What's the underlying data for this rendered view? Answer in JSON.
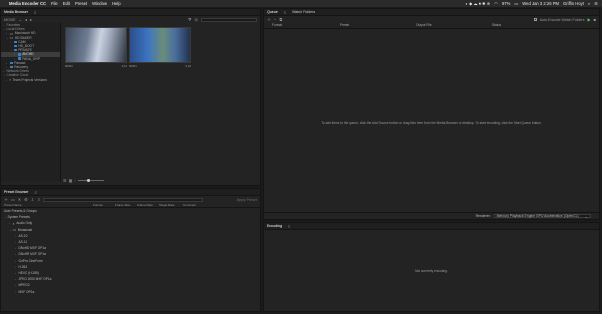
{
  "menubar": {
    "app_name": "Media Encoder CC",
    "items": [
      "File",
      "Edit",
      "Preset",
      "Window",
      "Help"
    ],
    "battery": "97%",
    "clock": "Wed Jan 3  2:26 PM",
    "user": "Griffin Hoyt"
  },
  "media_browser": {
    "title": "Media Browser",
    "path": "MOVIE",
    "tree": [
      {
        "label": "Favorites",
        "type": "section"
      },
      {
        "label": "Local Drives",
        "type": "section"
      },
      {
        "label": "Macintosh HD",
        "type": "drive"
      },
      {
        "label": "HD BAKER",
        "type": "drive"
      },
      {
        "label": "CAM",
        "type": "folder"
      },
      {
        "label": "HD_BOOT",
        "type": "folder"
      },
      {
        "label": "PRIVATE",
        "type": "folder"
      },
      {
        "label": "AVCHD",
        "type": "folder",
        "selected": true
      },
      {
        "label": "PANA_GRP",
        "type": "folder"
      },
      {
        "label": "Panasd",
        "type": "folder"
      },
      {
        "label": "Recovery",
        "type": "folder"
      },
      {
        "label": "Network Drives",
        "type": "section"
      },
      {
        "label": "Creative Cloud",
        "type": "section"
      },
      {
        "label": "Team Projects Versions",
        "type": "item"
      }
    ],
    "clips": [
      {
        "name": "00000",
        "duration": "0;11"
      },
      {
        "name": "00001",
        "duration": "0;22"
      }
    ]
  },
  "queue": {
    "tabs": [
      "Queue",
      "Watch Folders"
    ],
    "auto_encode_label": "Auto-Encode Watch Folders",
    "columns": [
      "Format",
      "Preset",
      "Output File",
      "Status"
    ],
    "empty_message": "To add items to the queue, click the Add Source button or drag files here from the Media Browser or desktop.  To start encoding, click the Start Queue button.",
    "renderer_label": "Renderer:",
    "renderer_value": "Mercury Playback Engine GPU Acceleration (OpenCL)"
  },
  "preset_browser": {
    "title": "Preset Browser",
    "apply_label": "Apply Preset",
    "columns": [
      "Preset Name",
      "Format",
      "Frame Size",
      "Frame Rate",
      "Target Rate",
      "Comment"
    ],
    "groups": [
      "User Presets & Groups",
      "System Presets"
    ],
    "presets": [
      "Audio Only",
      "Broadcast",
      "AS-10",
      "AS-11",
      "DNxHD MXF OP1a",
      "DNxHR MXF OP1a",
      "GoPro CineForm",
      "H.264",
      "HEVC (H.265)",
      "JPEG 2000 MXF OP1a",
      "MPEG2",
      "MXF OP1a"
    ]
  },
  "encoding": {
    "title": "Encoding",
    "empty_message": "Not currently encoding."
  }
}
